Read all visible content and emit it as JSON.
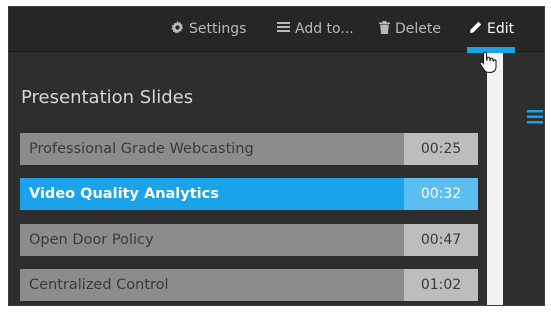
{
  "toolbar": {
    "settings_label": "Settings",
    "add_to_label": "Add to...",
    "delete_label": "Delete",
    "edit_label": "Edit"
  },
  "panel": {
    "title": "Presentation Slides"
  },
  "slides": [
    {
      "title": "Professional Grade Webcasting",
      "time": "00:25",
      "selected": false
    },
    {
      "title": "Video Quality Analytics",
      "time": "00:32",
      "selected": true
    },
    {
      "title": "Open Door Policy",
      "time": "00:47",
      "selected": false
    },
    {
      "title": "Centralized Control",
      "time": "01:02",
      "selected": false
    }
  ],
  "icons": {
    "settings": "gear-icon",
    "add_to": "list-icon",
    "delete": "trash-icon",
    "edit": "pencil-icon",
    "side": "menu-icon"
  },
  "colors": {
    "background": "#2e2e2e",
    "toolbar": "#262626",
    "accent": "#1aa3e8",
    "row": "#8c8c8c",
    "row_time": "#bdbdbd"
  }
}
